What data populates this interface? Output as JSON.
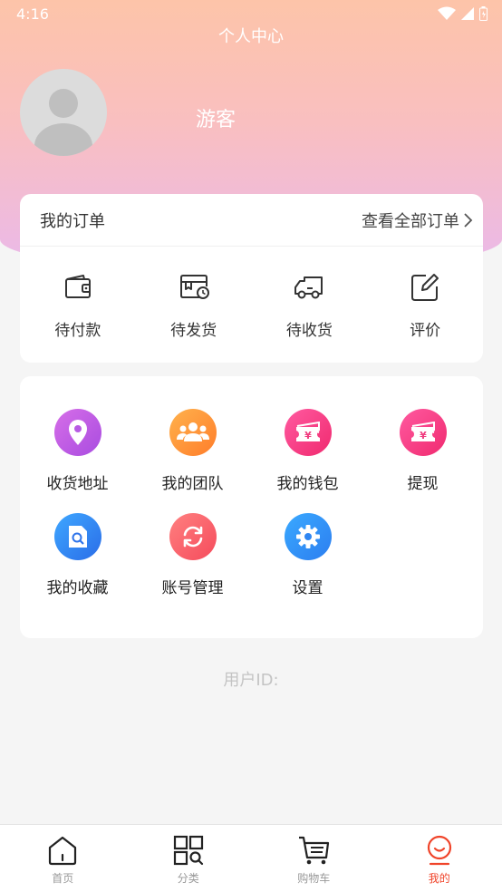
{
  "status_bar": {
    "time": "4:16"
  },
  "header": {
    "title": "个人中心",
    "username": "游客"
  },
  "orders": {
    "title": "我的订单",
    "view_all": "查看全部订单",
    "items": [
      {
        "label": "待付款",
        "icon": "wallet-icon"
      },
      {
        "label": "待发货",
        "icon": "pending-ship-icon"
      },
      {
        "label": "待收货",
        "icon": "truck-icon"
      },
      {
        "label": "评价",
        "icon": "edit-review-icon"
      }
    ]
  },
  "services": [
    {
      "label": "收货地址",
      "icon": "location-pin-icon",
      "color": "#c05ae6"
    },
    {
      "label": "我的团队",
      "icon": "team-icon",
      "color": "#ff9a3a"
    },
    {
      "label": "我的钱包",
      "icon": "wallet-ticket-icon",
      "color": "#f7428a"
    },
    {
      "label": "提现",
      "icon": "withdraw-ticket-icon",
      "color": "#f7428a"
    },
    {
      "label": "我的收藏",
      "icon": "favorites-doc-icon",
      "color": "#348af4"
    },
    {
      "label": "账号管理",
      "icon": "refresh-account-icon",
      "color": "#f7636b"
    },
    {
      "label": "设置",
      "icon": "gear-icon",
      "color": "#3190f5"
    }
  ],
  "user_id_label": "用户ID:",
  "tabbar": [
    {
      "label": "首页",
      "icon": "home-icon",
      "active": false
    },
    {
      "label": "分类",
      "icon": "category-icon",
      "active": false
    },
    {
      "label": "购物车",
      "icon": "cart-icon",
      "active": false
    },
    {
      "label": "我的",
      "icon": "profile-icon",
      "active": true
    }
  ],
  "colors": {
    "accent": "#f0442a",
    "header_top": "#fdc4a9",
    "header_bottom": "#eab9ea"
  }
}
